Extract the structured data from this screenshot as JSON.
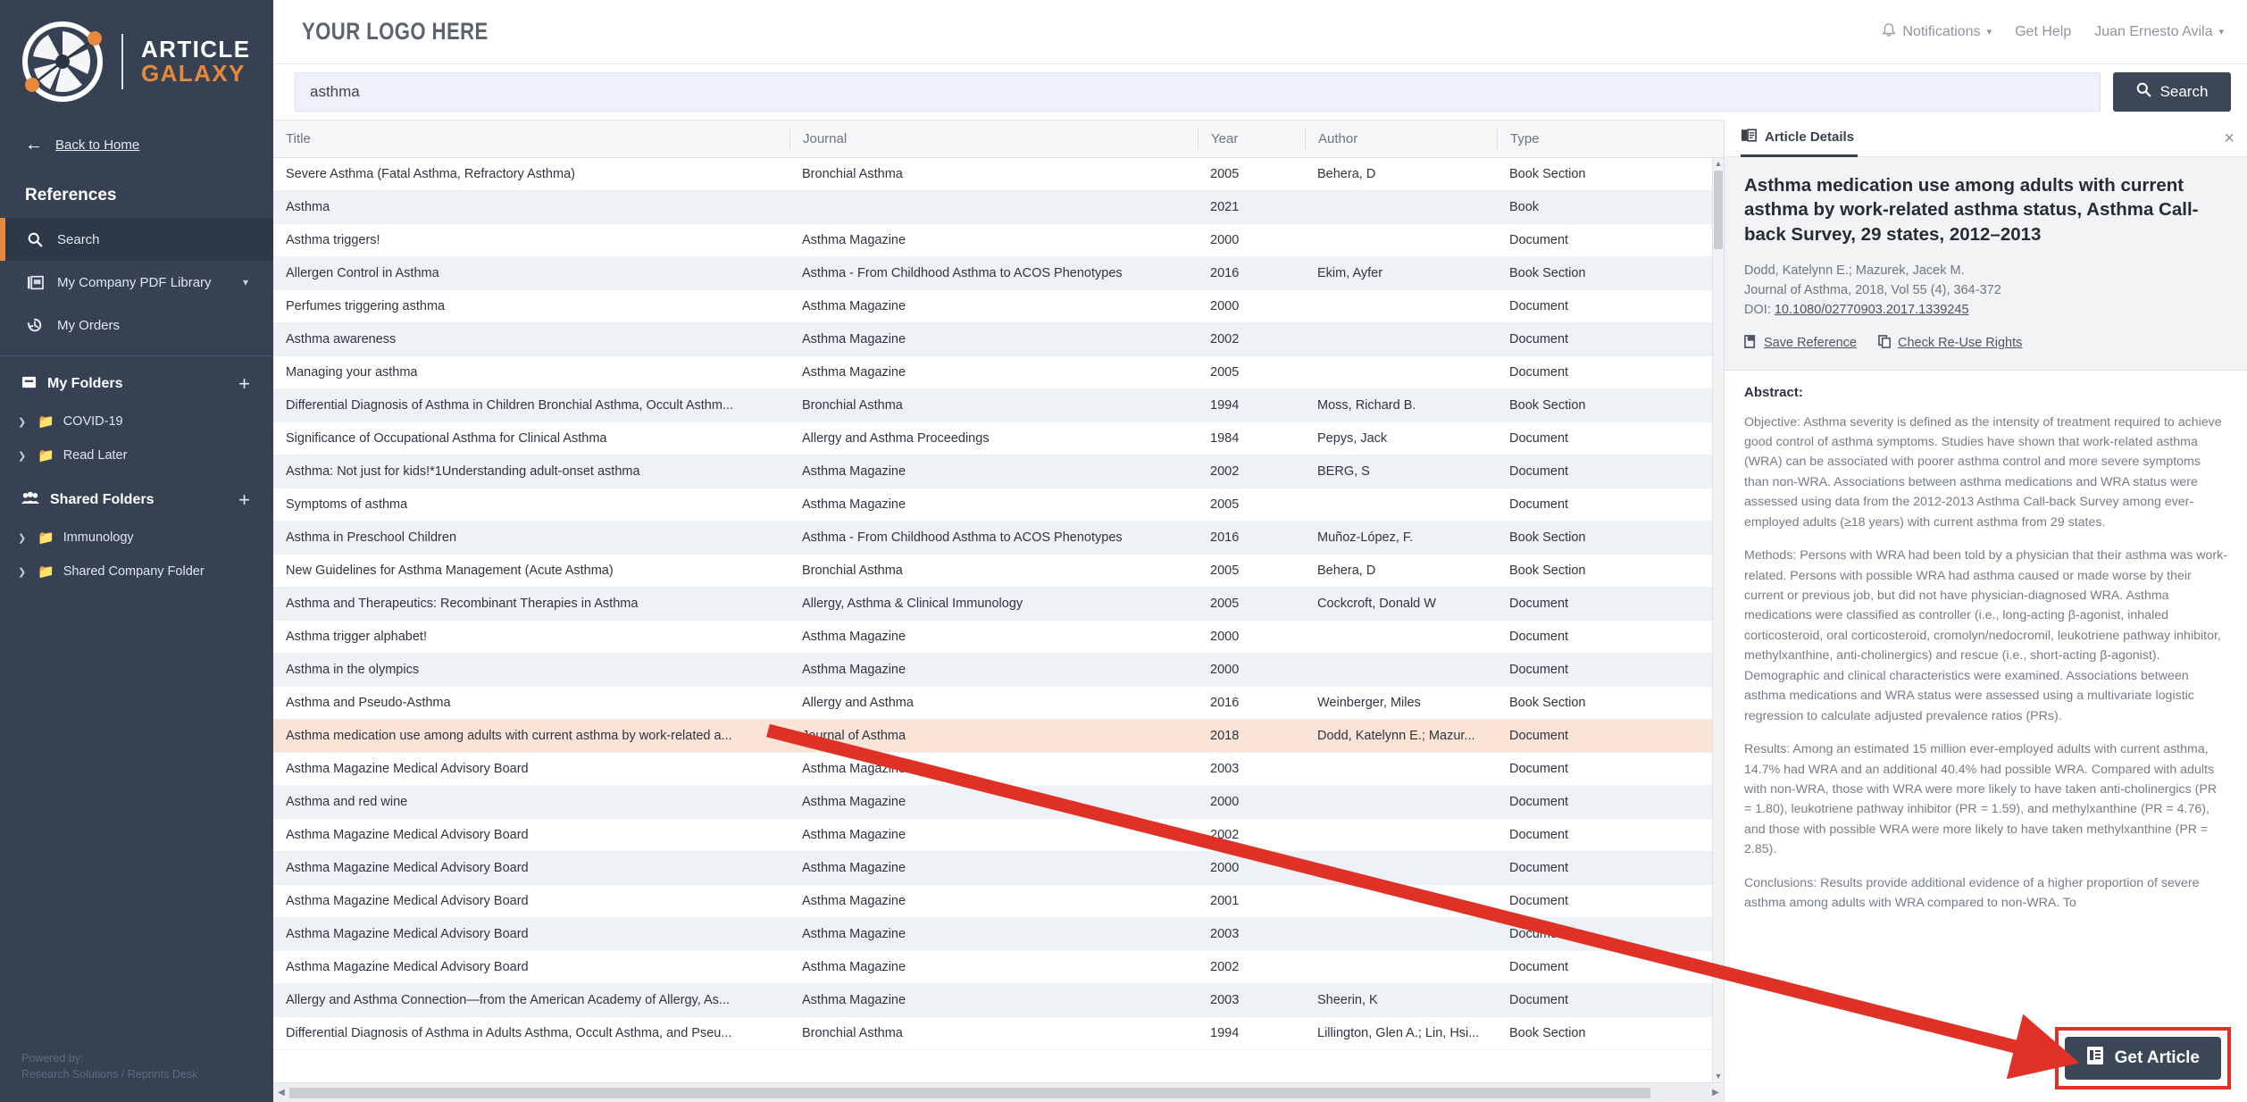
{
  "brand": {
    "name_line1": "ARTICLE",
    "name_line2": "GALAXY",
    "accent": "#e8883a",
    "sidebar_bg": "#364254"
  },
  "sidebar": {
    "back_home": "Back to Home",
    "section_title": "References",
    "nav": [
      {
        "label": "Search",
        "icon": "search-icon",
        "active": true
      },
      {
        "label": "My Company PDF Library",
        "icon": "pdf-library-icon",
        "active": false,
        "chevron": "∨"
      },
      {
        "label": "My Orders",
        "icon": "history-icon",
        "active": false
      }
    ],
    "my_folders": {
      "title": "My Folders",
      "add_label": "+",
      "items": [
        {
          "label": "COVID-19"
        },
        {
          "label": "Read Later"
        }
      ]
    },
    "shared_folders": {
      "title": "Shared Folders",
      "add_label": "+",
      "items": [
        {
          "label": "Immunology"
        },
        {
          "label": "Shared Company Folder"
        }
      ]
    },
    "powered_by_line1": "Powered by:",
    "powered_by_line2": "Research Solutions / Reprints Desk"
  },
  "topbar": {
    "logo_placeholder": "YOUR LOGO HERE",
    "notifications": "Notifications",
    "get_help": "Get Help",
    "user_name": "Juan Ernesto Avila",
    "caret": "▾"
  },
  "search": {
    "value": "asthma",
    "placeholder": "Search",
    "button_label": "Search"
  },
  "table": {
    "columns": [
      "Title",
      "Journal",
      "Year",
      "Author",
      "Type"
    ],
    "rows": [
      {
        "title": "Severe Asthma (Fatal Asthma, Refractory Asthma)",
        "journal": "Bronchial Asthma",
        "year": "2005",
        "author": "Behera, D",
        "type": "Book Section"
      },
      {
        "title": "Asthma",
        "journal": "",
        "year": "2021",
        "author": "",
        "type": "Book"
      },
      {
        "title": "Asthma triggers!",
        "journal": "Asthma Magazine",
        "year": "2000",
        "author": "",
        "type": "Document"
      },
      {
        "title": "Allergen Control in Asthma",
        "journal": "Asthma - From Childhood Asthma to ACOS Phenotypes",
        "year": "2016",
        "author": "Ekim, Ayfer",
        "type": "Book Section"
      },
      {
        "title": "Perfumes triggering asthma",
        "journal": "Asthma Magazine",
        "year": "2000",
        "author": "",
        "type": "Document"
      },
      {
        "title": "Asthma awareness",
        "journal": "Asthma Magazine",
        "year": "2002",
        "author": "",
        "type": "Document"
      },
      {
        "title": "Managing your asthma",
        "journal": "Asthma Magazine",
        "year": "2005",
        "author": "",
        "type": "Document"
      },
      {
        "title": "Differential Diagnosis of Asthma in Children Bronchial Asthma, Occult Asthm...",
        "journal": "Bronchial Asthma",
        "year": "1994",
        "author": "Moss, Richard B.",
        "type": "Book Section"
      },
      {
        "title": "Significance of Occupational Asthma for Clinical Asthma",
        "journal": "Allergy and Asthma Proceedings",
        "year": "1984",
        "author": "Pepys, Jack",
        "type": "Document"
      },
      {
        "title": "Asthma: Not just for kids!*1Understanding adult-onset asthma",
        "journal": "Asthma Magazine",
        "year": "2002",
        "author": "BERG, S",
        "type": "Document"
      },
      {
        "title": "Symptoms of asthma",
        "journal": "Asthma Magazine",
        "year": "2005",
        "author": "",
        "type": "Document"
      },
      {
        "title": "Asthma in Preschool Children",
        "journal": "Asthma - From Childhood Asthma to ACOS Phenotypes",
        "year": "2016",
        "author": "Muñoz-López, F.",
        "type": "Book Section"
      },
      {
        "title": "New Guidelines for Asthma Management (Acute Asthma)",
        "journal": "Bronchial Asthma",
        "year": "2005",
        "author": "Behera, D",
        "type": "Book Section"
      },
      {
        "title": "Asthma and Therapeutics: Recombinant Therapies in Asthma",
        "journal": "Allergy, Asthma & Clinical Immunology",
        "year": "2005",
        "author": "Cockcroft, Donald W",
        "type": "Document"
      },
      {
        "title": "Asthma trigger alphabet!",
        "journal": "Asthma Magazine",
        "year": "2000",
        "author": "",
        "type": "Document"
      },
      {
        "title": "Asthma in the olympics",
        "journal": "Asthma Magazine",
        "year": "2000",
        "author": "",
        "type": "Document"
      },
      {
        "title": "Asthma and Pseudo-Asthma",
        "journal": "Allergy and Asthma",
        "year": "2016",
        "author": "Weinberger, Miles",
        "type": "Book Section"
      },
      {
        "title": "Asthma medication use among adults with current asthma by work-related a...",
        "journal": "Journal of Asthma",
        "year": "2018",
        "author": "Dodd, Katelynn E.; Mazur...",
        "type": "Document",
        "selected": true
      },
      {
        "title": "Asthma Magazine Medical Advisory Board",
        "journal": "Asthma Magazine",
        "year": "2003",
        "author": "",
        "type": "Document"
      },
      {
        "title": "Asthma and red wine",
        "journal": "Asthma Magazine",
        "year": "2000",
        "author": "",
        "type": "Document"
      },
      {
        "title": "Asthma Magazine Medical Advisory Board",
        "journal": "Asthma Magazine",
        "year": "2002",
        "author": "",
        "type": "Document"
      },
      {
        "title": "Asthma Magazine Medical Advisory Board",
        "journal": "Asthma Magazine",
        "year": "2000",
        "author": "",
        "type": "Document"
      },
      {
        "title": "Asthma Magazine Medical Advisory Board",
        "journal": "Asthma Magazine",
        "year": "2001",
        "author": "",
        "type": "Document"
      },
      {
        "title": "Asthma Magazine Medical Advisory Board",
        "journal": "Asthma Magazine",
        "year": "2003",
        "author": "",
        "type": "Document"
      },
      {
        "title": "Asthma Magazine Medical Advisory Board",
        "journal": "Asthma Magazine",
        "year": "2002",
        "author": "",
        "type": "Document"
      },
      {
        "title": "Allergy and Asthma Connection—from the American Academy of Allergy, As...",
        "journal": "Asthma Magazine",
        "year": "2003",
        "author": "Sheerin, K",
        "type": "Document"
      },
      {
        "title": "Differential Diagnosis of Asthma in Adults Asthma, Occult Asthma, and Pseu...",
        "journal": "Bronchial Asthma",
        "year": "1994",
        "author": "Lillington, Glen A.; Lin, Hsi...",
        "type": "Book Section"
      }
    ]
  },
  "details": {
    "tab_label": "Article Details",
    "close_label": "×",
    "article_title": "Asthma medication use among adults with current asthma by work-related asthma status, Asthma Call-back Survey, 29 states, 2012–2013",
    "authors": "Dodd, Katelynn E.; Mazurek, Jacek M.",
    "citation": "Journal of Asthma, 2018, Vol 55 (4), 364-372",
    "doi_label": "DOI:",
    "doi_value": "10.1080/02770903.2017.1339245",
    "save_reference": "Save Reference",
    "check_reuse_rights": "Check Re-Use Rights",
    "abstract_label": "Abstract:",
    "abstract_paragraphs": [
      "Objective: Asthma severity is defined as the intensity of treatment required to achieve good control of asthma symptoms. Studies have shown that work-related asthma (WRA) can be associated with poorer asthma control and more severe symptoms than non-WRA. Associations between asthma medications and WRA status were assessed using data from the 2012-2013 Asthma Call-back Survey among ever-employed adults (≥18 years) with current asthma from 29 states.",
      "Methods: Persons with WRA had been told by a physician that their asthma was work-related. Persons with possible WRA had asthma caused or made worse by their current or previous job, but did not have physician-diagnosed WRA. Asthma medications were classified as controller (i.e., long-acting β-agonist, inhaled corticosteroid, oral corticosteroid, cromolyn/nedocromil, leukotriene pathway inhibitor, methylxanthine, anti-cholinergics) and rescue (i.e., short-acting β-agonist). Demographic and clinical characteristics were examined. Associations between asthma medications and WRA status were assessed using a multivariate logistic regression to calculate adjusted prevalence ratios (PRs).",
      "Results: Among an estimated 15 million ever-employed adults with current asthma, 14.7% had WRA and an additional 40.4% had possible WRA. Compared with adults with non-WRA, those with WRA were more likely to have taken anti-cholinergics (PR = 1.80), leukotriene pathway inhibitor (PR = 1.59), and methylxanthine (PR = 4.76), and those with possible WRA were more likely to have taken methylxanthine (PR = 2.85).",
      "Conclusions: Results provide additional evidence of a higher proportion of severe asthma among adults with WRA compared to non-WRA. To"
    ],
    "get_article_label": "Get Article"
  },
  "annotation": {
    "arrow_color": "#e03127",
    "highlight_border_color": "#e03127"
  }
}
